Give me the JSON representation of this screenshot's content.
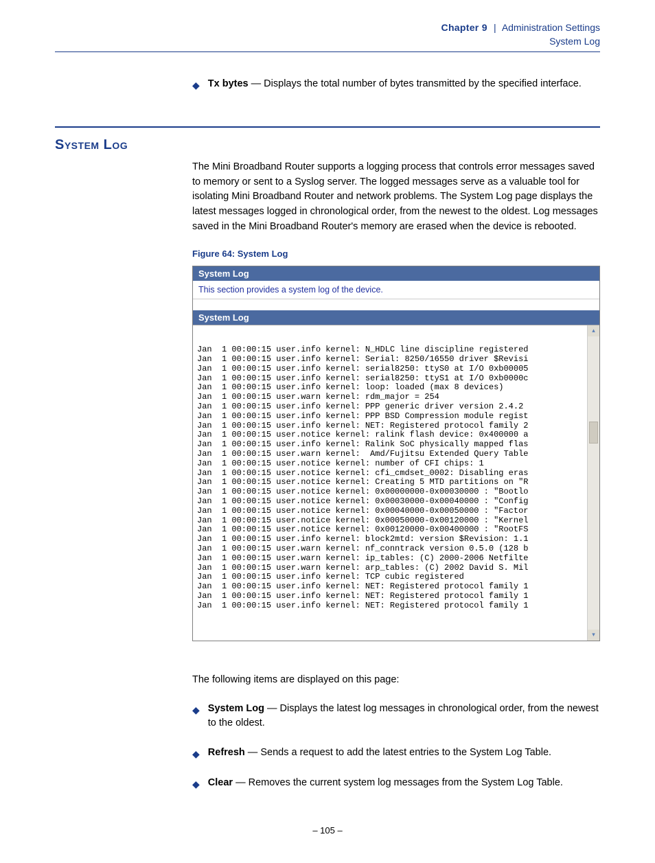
{
  "header": {
    "chapter_word": "Chapter",
    "chapter_num": "9",
    "chapter_title": "Administration Settings",
    "sub": "System Log"
  },
  "top_bullet": {
    "term": "Tx bytes",
    "desc": " — Displays the total number of bytes transmitted by the specified interface."
  },
  "section_title": "System Log",
  "section_para": "The Mini Broadband Router supports a logging process that controls error messages saved to memory or sent to a Syslog server. The logged messages serve as a valuable tool for isolating Mini Broadband Router and network problems. The System Log page displays the latest messages logged in chronological order, from the newest to the oldest. Log messages saved in the Mini Broadband Router's memory are erased when the device is rebooted.",
  "figure": {
    "caption": "Figure 64:  System Log",
    "bar1": "System Log",
    "desc": "This section provides a system log of the device.",
    "bar2": "System Log",
    "log_lines": [
      "Jan  1 00:00:15 user.info kernel: N_HDLC line discipline registered",
      "Jan  1 00:00:15 user.info kernel: Serial: 8250/16550 driver $Revisi",
      "Jan  1 00:00:15 user.info kernel: serial8250: ttyS0 at I/O 0xb00005",
      "Jan  1 00:00:15 user.info kernel: serial8250: ttyS1 at I/O 0xb0000c",
      "Jan  1 00:00:15 user.info kernel: loop: loaded (max 8 devices)",
      "Jan  1 00:00:15 user.warn kernel: rdm_major = 254",
      "Jan  1 00:00:15 user.info kernel: PPP generic driver version 2.4.2",
      "Jan  1 00:00:15 user.info kernel: PPP BSD Compression module regist",
      "Jan  1 00:00:15 user.info kernel: NET: Registered protocol family 2",
      "Jan  1 00:00:15 user.notice kernel: ralink flash device: 0x400000 a",
      "Jan  1 00:00:15 user.info kernel: Ralink SoC physically mapped flas",
      "Jan  1 00:00:15 user.warn kernel:  Amd/Fujitsu Extended Query Table",
      "Jan  1 00:00:15 user.notice kernel: number of CFI chips: 1",
      "Jan  1 00:00:15 user.notice kernel: cfi_cmdset_0002: Disabling eras",
      "Jan  1 00:00:15 user.notice kernel: Creating 5 MTD partitions on \"R",
      "Jan  1 00:00:15 user.notice kernel: 0x00000000-0x00030000 : \"Bootlo",
      "Jan  1 00:00:15 user.notice kernel: 0x00030000-0x00040000 : \"Config",
      "Jan  1 00:00:15 user.notice kernel: 0x00040000-0x00050000 : \"Factor",
      "Jan  1 00:00:15 user.notice kernel: 0x00050000-0x00120000 : \"Kernel",
      "Jan  1 00:00:15 user.notice kernel: 0x00120000-0x00400000 : \"RootFS",
      "Jan  1 00:00:15 user.info kernel: block2mtd: version $Revision: 1.1",
      "Jan  1 00:00:15 user.warn kernel: nf_conntrack version 0.5.0 (128 b",
      "Jan  1 00:00:15 user.warn kernel: ip_tables: (C) 2000-2006 Netfilte",
      "Jan  1 00:00:15 user.warn kernel: arp_tables: (C) 2002 David S. Mil",
      "Jan  1 00:00:15 user.info kernel: TCP cubic registered",
      "Jan  1 00:00:15 user.info kernel: NET: Registered protocol family 1",
      "Jan  1 00:00:15 user.info kernel: NET: Registered protocol family 1",
      "Jan  1 00:00:15 user.info kernel: NET: Registered protocol family 1"
    ]
  },
  "items_intro": "The following items are displayed on this page:",
  "items": [
    {
      "term": "System Log",
      "desc": " — Displays the latest log messages in chronological order, from the newest to the oldest."
    },
    {
      "term": "Refresh",
      "desc": " — Sends a request to add the latest entries to the System Log Table."
    },
    {
      "term": "Clear",
      "desc": " — Removes the current system log messages from the System Log Table."
    }
  ],
  "page_number": "–  105  –"
}
